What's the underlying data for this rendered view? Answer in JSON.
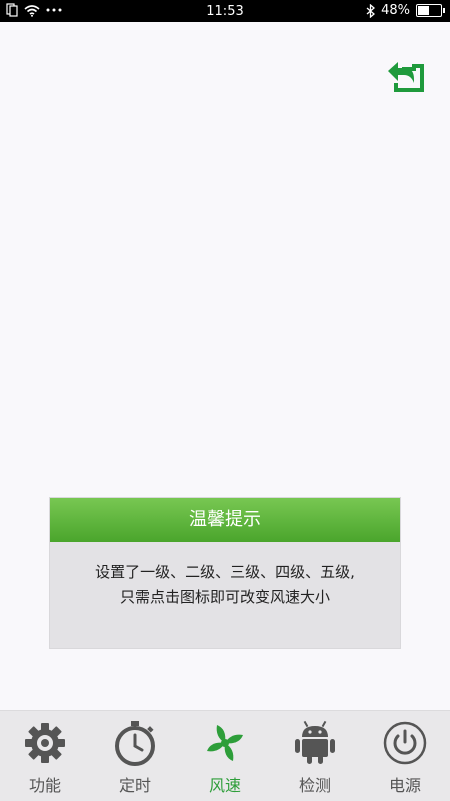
{
  "status_bar": {
    "time": "11:53",
    "battery_text": "48%",
    "battery_level": 0.48
  },
  "dialog": {
    "title": "温馨提示",
    "line1": "设置了一级、二级、三级、四级、五级,",
    "line2": "只需点击图标即可改变风速大小"
  },
  "tabs": [
    {
      "label": "功能",
      "icon": "gear-icon"
    },
    {
      "label": "定时",
      "icon": "stopwatch-icon"
    },
    {
      "label": "风速",
      "icon": "fan-icon",
      "active": true
    },
    {
      "label": "检测",
      "icon": "android-icon"
    },
    {
      "label": "电源",
      "icon": "power-icon"
    }
  ],
  "colors": {
    "accent_green": "#2e9e3a",
    "header_green": "#5cb53a",
    "icon_gray": "#555555"
  }
}
